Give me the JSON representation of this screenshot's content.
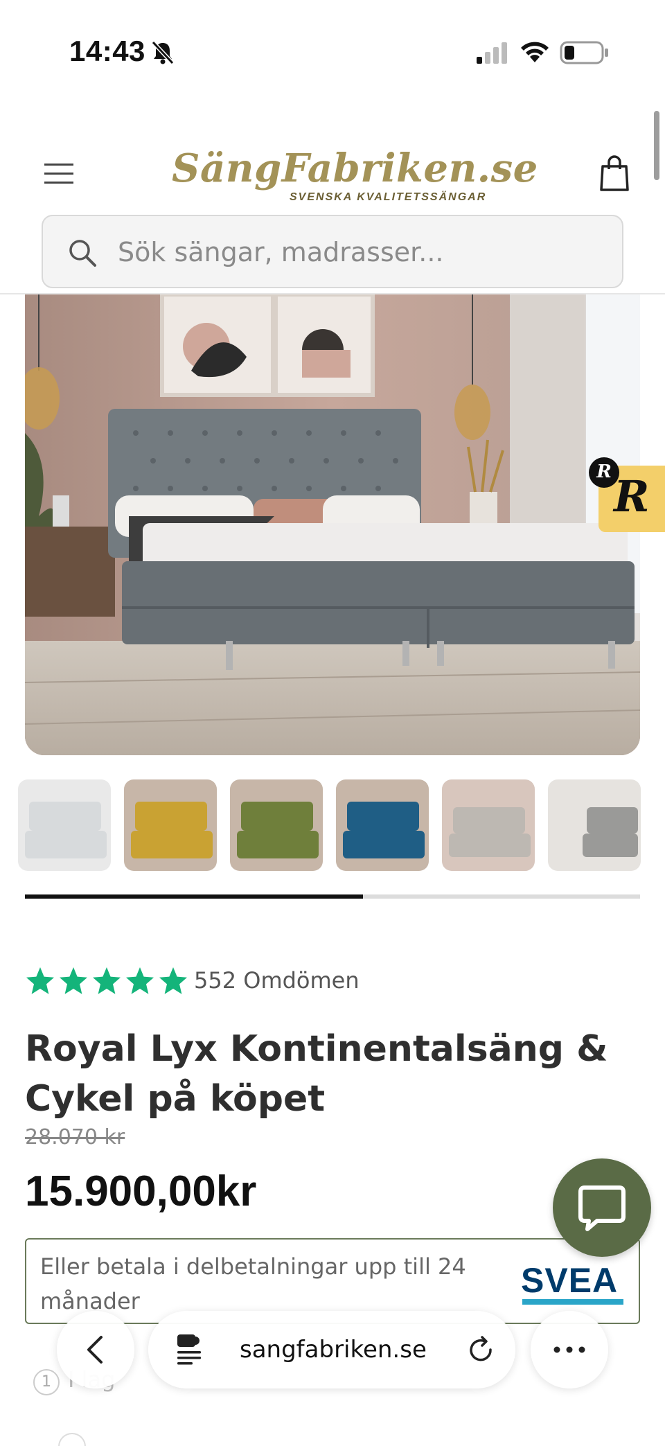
{
  "status_bar": {
    "time": "14:43"
  },
  "header": {
    "logo_main": "SängFabriken.se",
    "logo_sub": "SVENSKA KVALITETSSÄNGAR",
    "search_placeholder": "Sök sängar, madrasser..."
  },
  "reviews_badge": {
    "letter": "R",
    "dot_letter": "R"
  },
  "gallery": {
    "thumbnail_colors": [
      "#d7dadc",
      "#c9a233",
      "#6f7f3b",
      "#1f5e85",
      "#bdb8b2",
      "#9a9a98"
    ],
    "progress_fraction": 0.55
  },
  "product": {
    "rating_stars": 5,
    "star_color": "#14b47a",
    "review_count": "552 Omdömen",
    "title": "Royal Lyx Kontinentalsäng & Cykel på köpet",
    "old_price": "28.070 kr",
    "price": "15.900,00kr",
    "installment_text": "Eller betala i delbetalningar upp till 24 månader",
    "installment_logo": "SVEA",
    "quantity_badge": "1",
    "quantity_label": "I lag"
  },
  "browser": {
    "url": "sangfabriken.se"
  }
}
